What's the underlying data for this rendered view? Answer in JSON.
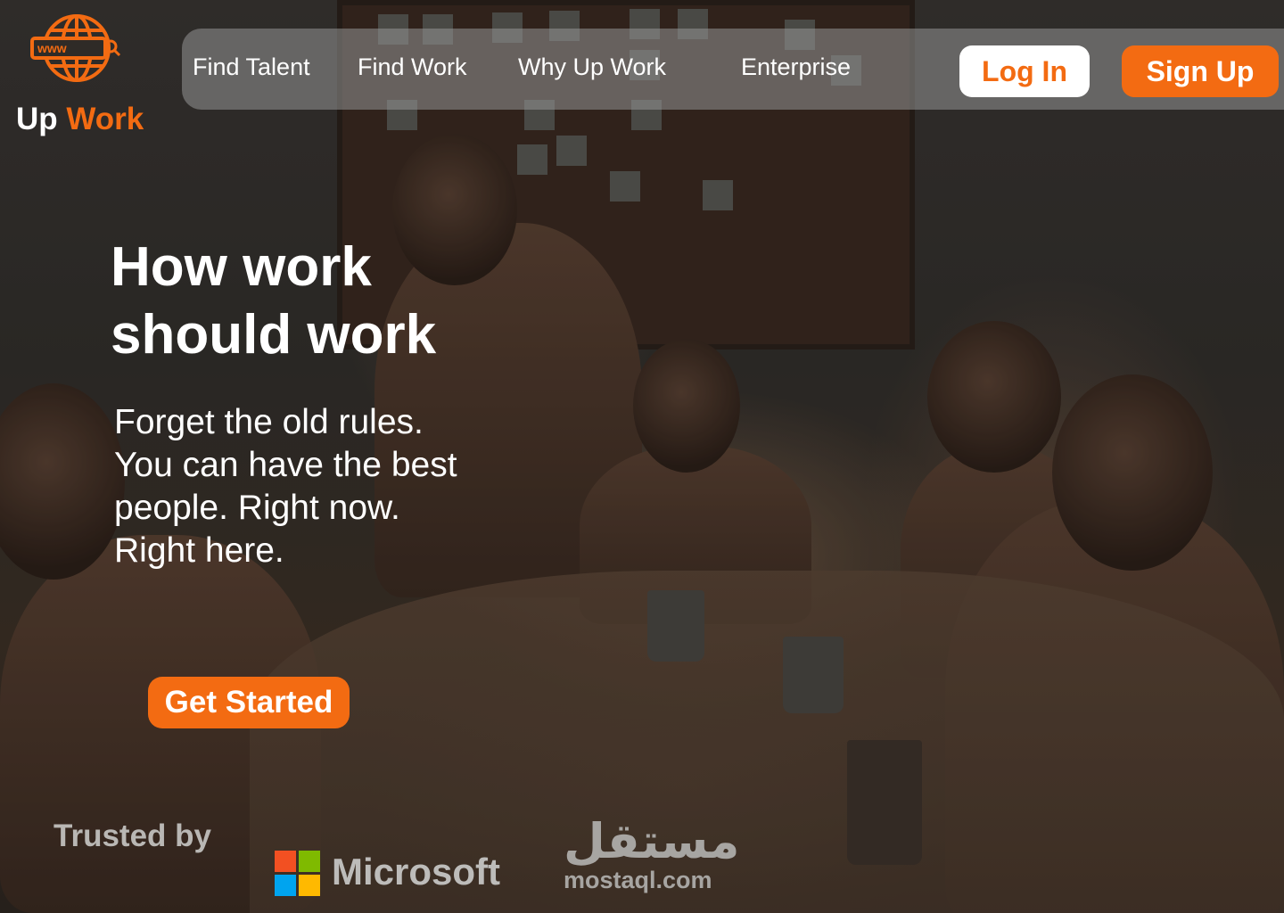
{
  "brand": {
    "name_part1": "Up",
    "name_part2": "Work",
    "icon_text": "www",
    "accent_color": "#f36b12"
  },
  "nav": {
    "links": [
      "Find Talent",
      "Find Work",
      "Why Up Work",
      "Enterprise"
    ],
    "login_label": "Log In",
    "signup_label": "Sign Up"
  },
  "hero": {
    "title_line1": "How work",
    "title_line2": "should work",
    "subtitle": "Forget the old rules. You can have the best people. Right now. Right here.",
    "cta_label": "Get Started"
  },
  "trusted": {
    "label": "Trusted by",
    "logos": {
      "microsoft": "Microsoft",
      "mostaql_arabic": "مستقل",
      "mostaql_domain": "mostaql.com"
    }
  }
}
